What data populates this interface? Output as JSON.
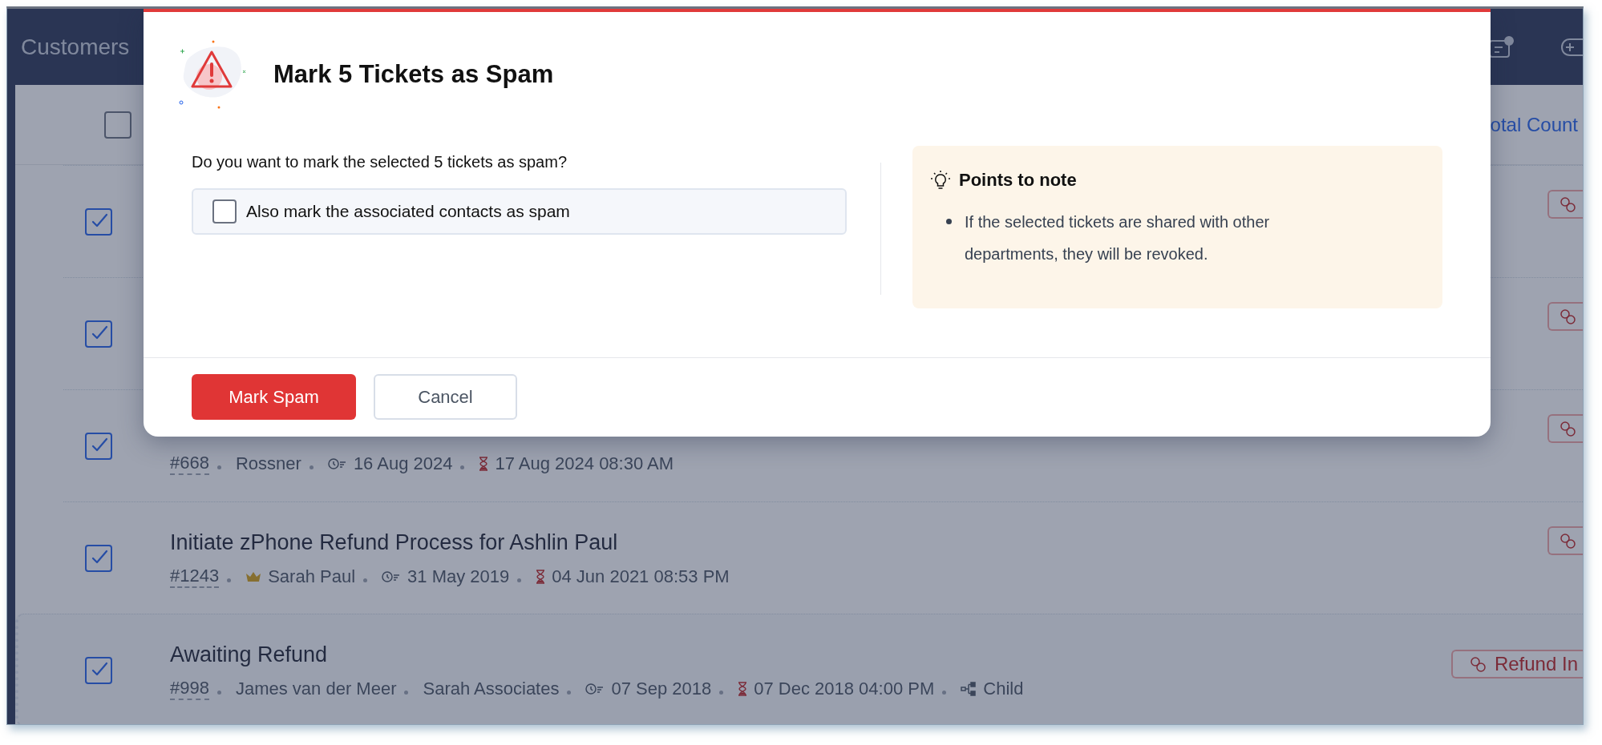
{
  "header": {
    "title": "Customers"
  },
  "list_header": {
    "select_all_checked": false,
    "total_count_label": "otal Count"
  },
  "rows": [
    {
      "checked": true,
      "focused": false,
      "title": null,
      "meta": [],
      "tag": null
    },
    {
      "checked": true,
      "focused": false,
      "title": null,
      "meta": [],
      "tag": null
    },
    {
      "checked": true,
      "focused": false,
      "title": null,
      "meta": [
        {
          "kind": "id",
          "text": "#668"
        },
        {
          "kind": "contact",
          "text": "Rossner"
        },
        {
          "kind": "created",
          "text": "16 Aug 2024"
        },
        {
          "kind": "due",
          "text": "17 Aug 2024 08:30 AM"
        }
      ],
      "tag": null
    },
    {
      "checked": true,
      "focused": false,
      "title": "Initiate zPhone Refund Process for Ashlin Paul",
      "meta": [
        {
          "kind": "id",
          "text": "#1243"
        },
        {
          "kind": "vip_contact",
          "text": "Sarah Paul"
        },
        {
          "kind": "created",
          "text": "31 May 2019"
        },
        {
          "kind": "due",
          "text": "04 Jun 2021 08:53 PM"
        }
      ],
      "tag": null
    },
    {
      "checked": true,
      "focused": true,
      "title": "Awaiting Refund",
      "meta": [
        {
          "kind": "id",
          "text": "#998"
        },
        {
          "kind": "contact",
          "text": "James van der Meer"
        },
        {
          "kind": "account",
          "text": "Sarah Associates"
        },
        {
          "kind": "created",
          "text": "07 Sep 2018"
        },
        {
          "kind": "due",
          "text": "07 Dec 2018 04:00 PM"
        },
        {
          "kind": "relation",
          "text": "Child"
        }
      ],
      "tag": "Refund In"
    }
  ],
  "dialog": {
    "title": "Mark 5 Tickets as Spam",
    "question": "Do you want to mark the selected 5 tickets as spam?",
    "option": {
      "label": "Also mark the associated contacts as spam",
      "checked": false
    },
    "note": {
      "title": "Points to note",
      "points": [
        "If the selected tickets are shared with other departments, they will be revoked."
      ]
    },
    "buttons": [
      {
        "kind": "primary",
        "label": "Mark Spam"
      },
      {
        "kind": "secondary",
        "label": "Cancel"
      }
    ]
  }
}
